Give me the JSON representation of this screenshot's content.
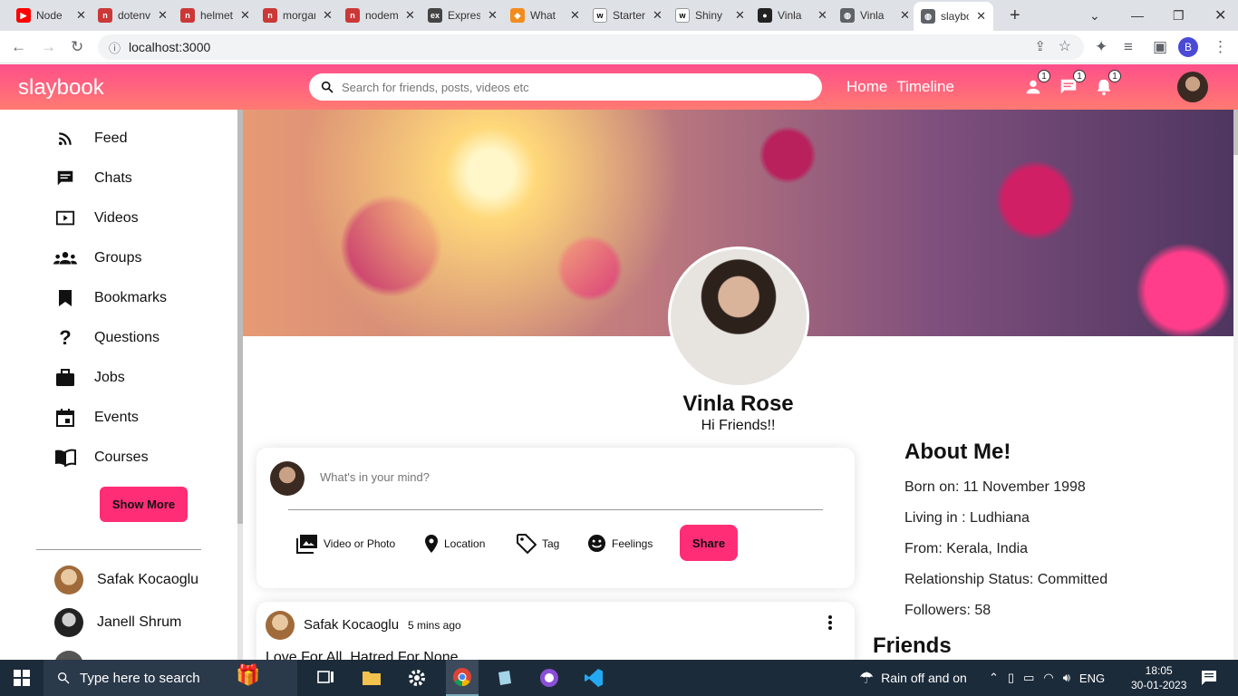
{
  "browser": {
    "tabs": [
      {
        "label": "Node",
        "color": "#ff0000",
        "glyph": "▶"
      },
      {
        "label": "dotenv",
        "color": "#cb3837",
        "glyph": "n"
      },
      {
        "label": "helmet",
        "color": "#cb3837",
        "glyph": "n"
      },
      {
        "label": "morgan",
        "color": "#cb3837",
        "glyph": "n"
      },
      {
        "label": "nodemon",
        "color": "#cb3837",
        "glyph": "n"
      },
      {
        "label": "Express",
        "color": "#444444",
        "glyph": "ex"
      },
      {
        "label": "What",
        "color": "#f28c1c",
        "glyph": "◆"
      },
      {
        "label": "Starter",
        "color": "#ffffff",
        "glyph": "w"
      },
      {
        "label": "Shiny",
        "color": "#ffffff",
        "glyph": "w"
      },
      {
        "label": "Vinla",
        "color": "#222222",
        "glyph": "●"
      },
      {
        "label": "Vinla",
        "color": "#5f6368",
        "glyph": "◍"
      },
      {
        "label": "slaybook",
        "color": "#5f6368",
        "glyph": "◍"
      }
    ],
    "url": "localhost:3000",
    "profile_initial": "B"
  },
  "appbar": {
    "logo": "slaybook",
    "search_placeholder": "Search for friends, posts, videos etc",
    "nav": {
      "home": "Home",
      "timeline": "Timeline"
    },
    "badges": {
      "person": "1",
      "chat": "1",
      "notifications": "1"
    }
  },
  "sidebar": {
    "items": [
      {
        "label": "Feed"
      },
      {
        "label": "Chats"
      },
      {
        "label": "Videos"
      },
      {
        "label": "Groups"
      },
      {
        "label": "Bookmarks"
      },
      {
        "label": "Questions"
      },
      {
        "label": "Jobs"
      },
      {
        "label": "Events"
      },
      {
        "label": "Courses"
      }
    ],
    "show_more": "Show More",
    "friends": [
      {
        "name": "Safak Kocaoglu"
      },
      {
        "name": "Janell Shrum"
      }
    ]
  },
  "profile": {
    "name": "Vinla Rose",
    "desc": "Hi Friends!!"
  },
  "share": {
    "placeholder": "What's in your mind?",
    "options": {
      "media": "Video or Photo",
      "location": "Location",
      "tag": "Tag",
      "feelings": "Feelings"
    },
    "button": "Share"
  },
  "post": {
    "author": "Safak Kocaoglu",
    "time": "5 mins ago",
    "text": "Love For All, Hatred For None."
  },
  "about": {
    "title": "About Me!",
    "born": "Born on: 11 November 1998",
    "living": "Living in : Ludhiana",
    "from": "From: Kerala, India",
    "relationship": "Relationship Status: Committed",
    "followers": "Followers: 58"
  },
  "friends_title": "Friends",
  "taskbar": {
    "search_placeholder": "Type here to search",
    "weather": "Rain off and on",
    "lang": "ENG",
    "time": "18:05",
    "date": "30-01-2023"
  },
  "colors": {
    "accent": "#ff2d75",
    "appbar_top": "#ff4f8a",
    "appbar_bottom": "#ff7a72"
  }
}
